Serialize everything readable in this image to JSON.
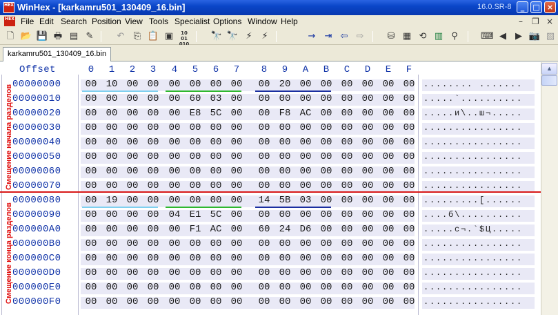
{
  "window": {
    "logo_text": "HEX",
    "title": "WinHex - [karkamru501_130409_16.bin]",
    "version": "16.0.SR-8",
    "buttons": {
      "minimize": "_",
      "maximize": "□",
      "close": "×"
    }
  },
  "menu": {
    "items": [
      "File",
      "Edit",
      "Search",
      "Position",
      "View",
      "Tools",
      "Specialist",
      "Options",
      "Window",
      "Help"
    ],
    "mdi_controls": {
      "minimize": "–",
      "restore": "❐",
      "close": "×"
    }
  },
  "toolbar": {
    "icons": [
      "new-file-icon",
      "open-file-icon",
      "save-icon",
      "print-icon",
      "properties-icon",
      "edit-icon",
      "undo-icon",
      "copy-icon",
      "paste-icon",
      "paste-special-icon",
      "hex-convert-icon",
      "find-text-icon",
      "find-hex-icon",
      "replace-text-icon",
      "replace-hex-icon",
      "goto-offset-icon",
      "goto-sector-icon",
      "back-icon",
      "forward-icon",
      "disk-icon",
      "ram-icon",
      "hash-icon",
      "calculator-icon",
      "search-icon",
      "keyboard-icon",
      "prev-icon",
      "next-icon",
      "camera-icon",
      "cube-icon"
    ],
    "convert_label": "10 01 010"
  },
  "tab": {
    "label": "karkamru501_130409_16.bin"
  },
  "hex": {
    "offset_header": "Offset",
    "columns": [
      "0",
      "1",
      "2",
      "3",
      "4",
      "5",
      "6",
      "7",
      "8",
      "9",
      "A",
      "B",
      "C",
      "D",
      "E",
      "F"
    ],
    "rows": [
      {
        "offset": "00000000",
        "bytes": [
          "00",
          "10",
          "00",
          "00",
          "00",
          "00",
          "00",
          "00",
          "00",
          "20",
          "00",
          "00",
          "00",
          "00",
          "00",
          "00"
        ],
        "text": "........ ......."
      },
      {
        "offset": "00000010",
        "bytes": [
          "00",
          "00",
          "00",
          "00",
          "00",
          "60",
          "03",
          "00",
          "00",
          "00",
          "00",
          "00",
          "00",
          "00",
          "00",
          "00"
        ],
        "text": ".....`.........."
      },
      {
        "offset": "00000020",
        "bytes": [
          "00",
          "00",
          "00",
          "00",
          "00",
          "E8",
          "5C",
          "00",
          "00",
          "F8",
          "AC",
          "00",
          "00",
          "00",
          "00",
          "00"
        ],
        "text": ".....и\\..ш¬....."
      },
      {
        "offset": "00000030",
        "bytes": [
          "00",
          "00",
          "00",
          "00",
          "00",
          "00",
          "00",
          "00",
          "00",
          "00",
          "00",
          "00",
          "00",
          "00",
          "00",
          "00"
        ],
        "text": "................"
      },
      {
        "offset": "00000040",
        "bytes": [
          "00",
          "00",
          "00",
          "00",
          "00",
          "00",
          "00",
          "00",
          "00",
          "00",
          "00",
          "00",
          "00",
          "00",
          "00",
          "00"
        ],
        "text": "................"
      },
      {
        "offset": "00000050",
        "bytes": [
          "00",
          "00",
          "00",
          "00",
          "00",
          "00",
          "00",
          "00",
          "00",
          "00",
          "00",
          "00",
          "00",
          "00",
          "00",
          "00"
        ],
        "text": "................"
      },
      {
        "offset": "00000060",
        "bytes": [
          "00",
          "00",
          "00",
          "00",
          "00",
          "00",
          "00",
          "00",
          "00",
          "00",
          "00",
          "00",
          "00",
          "00",
          "00",
          "00"
        ],
        "text": "................"
      },
      {
        "offset": "00000070",
        "bytes": [
          "00",
          "00",
          "00",
          "00",
          "00",
          "00",
          "00",
          "00",
          "00",
          "00",
          "00",
          "00",
          "00",
          "00",
          "00",
          "00"
        ],
        "text": "................"
      },
      {
        "offset": "00000080",
        "bytes": [
          "00",
          "19",
          "00",
          "00",
          "00",
          "00",
          "00",
          "00",
          "14",
          "5B",
          "03",
          "00",
          "00",
          "00",
          "00",
          "00"
        ],
        "text": ".........[......"
      },
      {
        "offset": "00000090",
        "bytes": [
          "00",
          "00",
          "00",
          "00",
          "04",
          "E1",
          "5C",
          "00",
          "00",
          "00",
          "00",
          "00",
          "00",
          "00",
          "00",
          "00"
        ],
        "text": "....б\\.........."
      },
      {
        "offset": "000000A0",
        "bytes": [
          "00",
          "00",
          "00",
          "00",
          "00",
          "F1",
          "AC",
          "00",
          "60",
          "24",
          "D6",
          "00",
          "00",
          "00",
          "00",
          "00"
        ],
        "text": ".....с¬.`$Ц....."
      },
      {
        "offset": "000000B0",
        "bytes": [
          "00",
          "00",
          "00",
          "00",
          "00",
          "00",
          "00",
          "00",
          "00",
          "00",
          "00",
          "00",
          "00",
          "00",
          "00",
          "00"
        ],
        "text": "................"
      },
      {
        "offset": "000000C0",
        "bytes": [
          "00",
          "00",
          "00",
          "00",
          "00",
          "00",
          "00",
          "00",
          "00",
          "00",
          "00",
          "00",
          "00",
          "00",
          "00",
          "00"
        ],
        "text": "................"
      },
      {
        "offset": "000000D0",
        "bytes": [
          "00",
          "00",
          "00",
          "00",
          "00",
          "00",
          "00",
          "00",
          "00",
          "00",
          "00",
          "00",
          "00",
          "00",
          "00",
          "00"
        ],
        "text": "................"
      },
      {
        "offset": "000000E0",
        "bytes": [
          "00",
          "00",
          "00",
          "00",
          "00",
          "00",
          "00",
          "00",
          "00",
          "00",
          "00",
          "00",
          "00",
          "00",
          "00",
          "00"
        ],
        "text": "................"
      },
      {
        "offset": "000000F0",
        "bytes": [
          "00",
          "00",
          "00",
          "00",
          "00",
          "00",
          "00",
          "00",
          "00",
          "00",
          "00",
          "00",
          "00",
          "00",
          "00",
          "00"
        ],
        "text": "................"
      }
    ]
  },
  "annotations": {
    "start_label": "Смещение начала разделов",
    "end_label": "Смещение конца разделов",
    "underline_colors": [
      "#7fd0f0",
      "#2fb82f",
      "#1b2fa0"
    ],
    "separator_color": "#d81818"
  }
}
